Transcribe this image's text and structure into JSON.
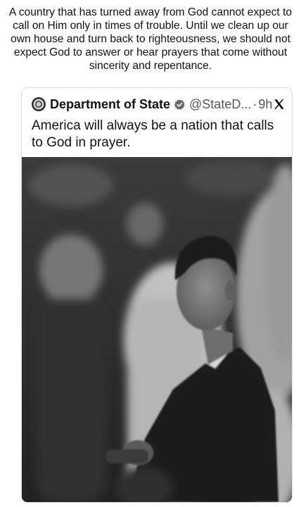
{
  "caption": "A country that has turned away from God cannot expect to call on Him only in times of trouble. Until we clean up our own house and turn back to righteousness, we should not expect God to answer or hear prayers that come without sincerity and repentance.",
  "post": {
    "author_name": "Department of State",
    "handle": "@StateD...",
    "separator": "·",
    "time": "9h",
    "text": "America will always be a nation that calls to God in prayer."
  },
  "icons": {
    "avatar": "department-of-state-seal",
    "verified": "verified-badge-icon",
    "platform": "x-logo-icon"
  },
  "colors": {
    "background": "#ffffff",
    "card_border": "#dcdcdc",
    "muted_text": "#555555",
    "photo_tone": "grayscale"
  }
}
